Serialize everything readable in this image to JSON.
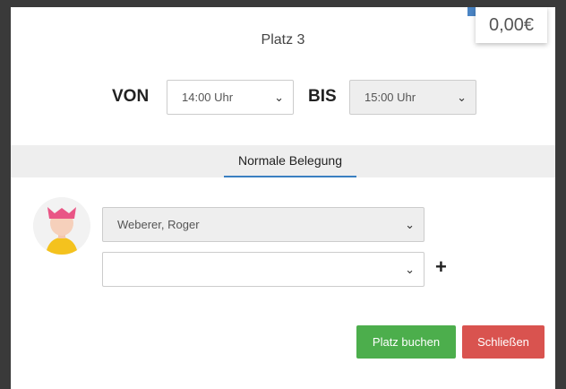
{
  "price": "0,00€",
  "title": "Platz 3",
  "time": {
    "from_label": "VON",
    "from_value": "14:00 Uhr",
    "to_label": "BIS",
    "to_value": "15:00 Uhr"
  },
  "tab": {
    "label": "Normale Belegung"
  },
  "players": {
    "player1": "Weberer, Roger",
    "player2": "",
    "add_symbol": "+"
  },
  "buttons": {
    "book": "Platz buchen",
    "close": "Schließen"
  },
  "colors": {
    "book": "#4cae4c",
    "close": "#d9534f",
    "accent": "#3a7fc1"
  }
}
